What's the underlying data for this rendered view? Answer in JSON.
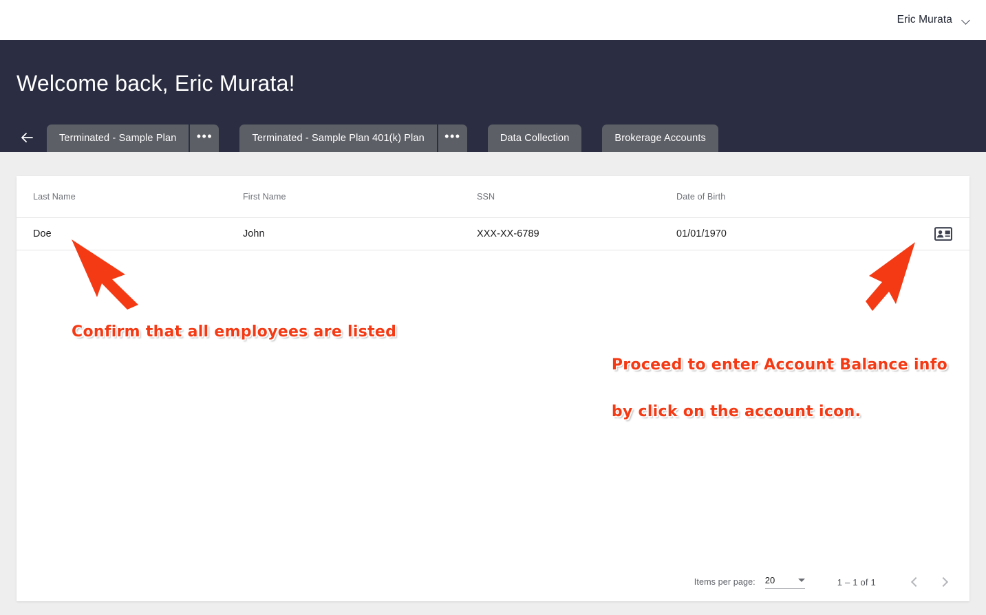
{
  "topbar": {
    "user_name": "Eric Murata",
    "chevron_icon": "chevron-down-icon"
  },
  "hero": {
    "welcome_title": "Welcome back, Eric Murata!",
    "background_color": "#2b2e42",
    "back_icon": "arrow-left-icon"
  },
  "tabs": [
    {
      "label": "Terminated - Sample Plan",
      "has_menu": true,
      "menu_label": "•••"
    },
    {
      "label": "Terminated - Sample Plan 401(k) Plan",
      "has_menu": true,
      "menu_label": "•••"
    },
    {
      "label": "Data Collection",
      "has_menu": false,
      "menu_label": ""
    },
    {
      "label": "Brokerage Accounts",
      "has_menu": false,
      "menu_label": ""
    }
  ],
  "table": {
    "columns": [
      "Last Name",
      "First Name",
      "SSN",
      "Date of Birth",
      ""
    ],
    "rows": [
      {
        "last_name": "Doe",
        "first_name": "John",
        "ssn": "XXX-XX-6789",
        "dob": "01/01/1970",
        "action_icon": "account-card-icon"
      }
    ]
  },
  "paginator": {
    "items_per_page_label": "Items per page:",
    "items_per_page_value": "20",
    "range_label": "1 – 1 of 1",
    "prev_icon": "chevron-left-icon",
    "next_icon": "chevron-right-icon"
  },
  "annotations": {
    "color": "#f43a14",
    "note_left": "Confirm that all employees are listed",
    "note_right_line1": "Proceed to enter Account Balance info",
    "note_right_line2": "by click on the account icon.",
    "arrow_left": "red-arrow-up-left",
    "arrow_right": "red-arrow-up-right"
  }
}
